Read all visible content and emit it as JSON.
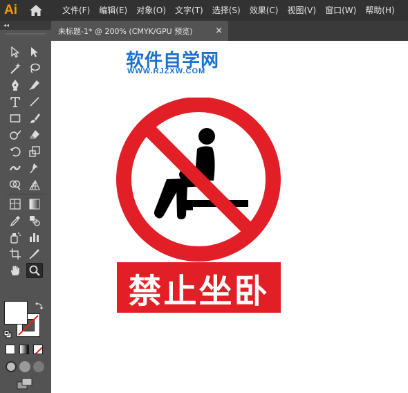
{
  "app": {
    "logo_text": "Ai"
  },
  "menu": {
    "items": [
      "文件(F)",
      "编辑(E)",
      "对象(O)",
      "文字(T)",
      "选择(S)",
      "效果(C)",
      "视图(V)",
      "窗口(W)",
      "帮助(H)"
    ]
  },
  "document": {
    "tab_title": "未标题-1* @ 200% (CMYK/GPU 预览)",
    "close_glyph": "×"
  },
  "artwork": {
    "watermark_title": "软件自学网",
    "watermark_url": "WWW.RJZXW.COM",
    "sign_text": "禁止坐卧",
    "colors": {
      "sign_red": "#e21f26",
      "watermark_blue": "#1a6fd0",
      "figure": "#000000"
    }
  },
  "toolbar": {
    "collapse_glyph": "◂◂",
    "more_glyph": "•••",
    "tools": [
      "selection-tool",
      "direct-selection-tool",
      "magic-wand-tool",
      "lasso-tool",
      "pen-tool",
      "curvature-tool",
      "type-tool",
      "line-segment-tool",
      "rectangle-tool",
      "paintbrush-tool",
      "shaper-tool",
      "eraser-tool",
      "rotate-tool",
      "scale-tool",
      "width-tool",
      "puppet-warp-tool",
      "shape-builder-tool",
      "perspective-grid-tool",
      "mesh-tool",
      "gradient-tool",
      "eyedropper-tool",
      "blend-tool",
      "symbol-sprayer-tool",
      "column-graph-tool",
      "artboard-tool",
      "slice-tool",
      "hand-tool",
      "zoom-tool"
    ],
    "active_tool": "zoom-tool"
  }
}
